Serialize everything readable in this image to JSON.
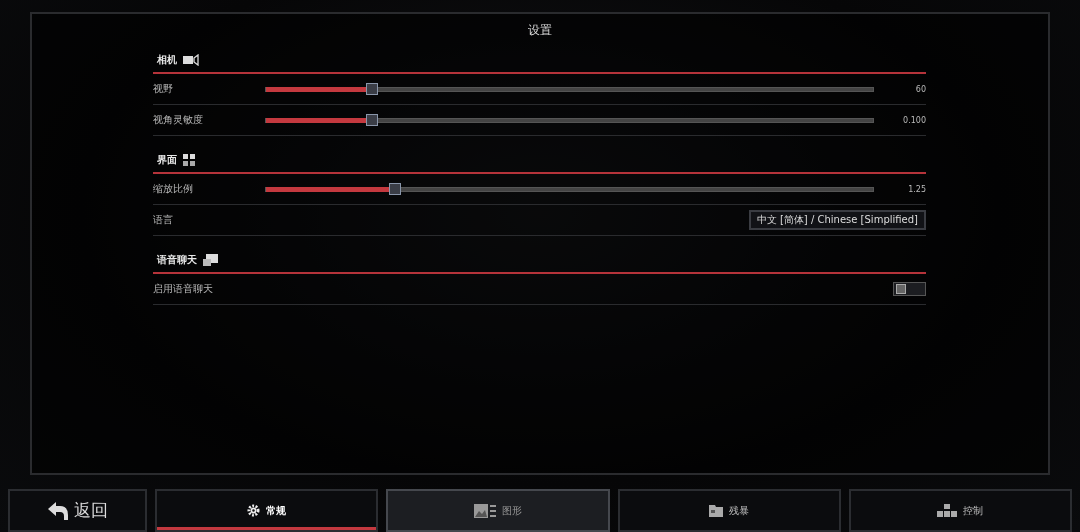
{
  "title": "设置",
  "sections": [
    {
      "title": "相机",
      "rows": [
        {
          "kind": "slider",
          "label": "视野",
          "level": 0.174,
          "reading": "60"
        },
        {
          "kind": "slider",
          "label": "视角灵敏度",
          "level": 0.174,
          "reading": "0.100"
        }
      ]
    },
    {
      "title": "界面",
      "rows": [
        {
          "kind": "slider",
          "label": "缩放比例",
          "level": 0.212,
          "reading": "1.25"
        },
        {
          "kind": "dropdown",
          "label": "语言",
          "value": "中文 [简体] / Chinese [Simplified]"
        }
      ]
    },
    {
      "title": "语音聊天",
      "rows": [
        {
          "kind": "toggle",
          "label": "启用语音聊天",
          "on": false
        }
      ]
    }
  ],
  "back_button": {
    "label": "返回"
  },
  "tabs": [
    {
      "label": "常规",
      "selected": true,
      "highlighted": false
    },
    {
      "label": "图形",
      "selected": false,
      "highlighted": true
    },
    {
      "label": "残暴",
      "selected": false,
      "highlighted": false
    },
    {
      "label": "控制",
      "selected": false,
      "highlighted": false
    }
  ]
}
